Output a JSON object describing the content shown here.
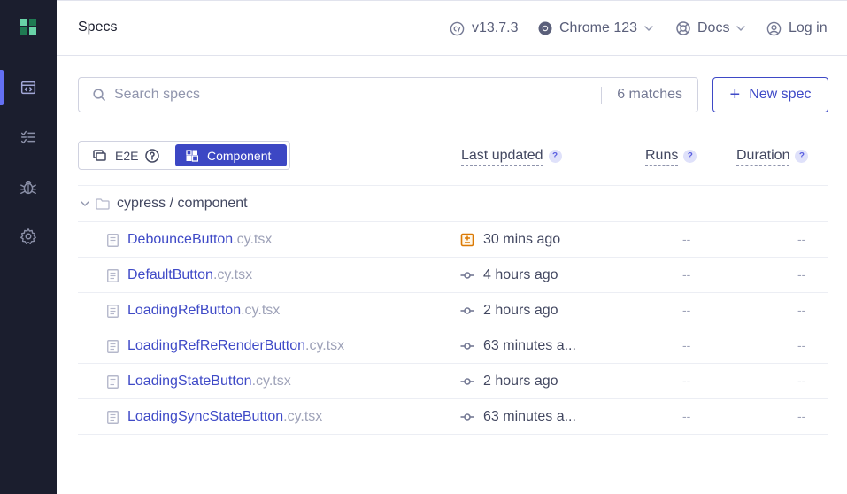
{
  "header": {
    "title": "Specs",
    "version": "v13.7.3",
    "browser": "Chrome 123",
    "docs": "Docs",
    "login": "Log in"
  },
  "sidebar": {
    "items": [
      {
        "icon": "specs-icon",
        "active": true
      },
      {
        "icon": "runs-icon",
        "active": false
      },
      {
        "icon": "debug-icon",
        "active": false
      },
      {
        "icon": "settings-icon",
        "active": false
      }
    ]
  },
  "search": {
    "placeholder": "Search specs",
    "matches": "6 matches",
    "value": ""
  },
  "new_spec_label": "New spec",
  "testing_type": {
    "e2e_label": "E2E",
    "component_label": "Component",
    "selected": "Component"
  },
  "columns": {
    "last_updated": "Last updated",
    "runs": "Runs",
    "duration": "Duration",
    "help": "?"
  },
  "folder": {
    "path": "cypress / component"
  },
  "specs": [
    {
      "name": "DebounceButton",
      "ext": ".cy.tsx",
      "updated": "30 mins ago",
      "updated_icon": "modified-file-icon",
      "runs": "--",
      "duration": "--"
    },
    {
      "name": "DefaultButton",
      "ext": ".cy.tsx",
      "updated": "4 hours ago",
      "updated_icon": "commit-icon",
      "runs": "--",
      "duration": "--"
    },
    {
      "name": "LoadingRefButton",
      "ext": ".cy.tsx",
      "updated": "2 hours ago",
      "updated_icon": "commit-icon",
      "runs": "--",
      "duration": "--"
    },
    {
      "name": "LoadingRefReRenderButton",
      "ext": ".cy.tsx",
      "updated": "63 minutes a...",
      "updated_icon": "commit-icon",
      "runs": "--",
      "duration": "--"
    },
    {
      "name": "LoadingStateButton",
      "ext": ".cy.tsx",
      "updated": "2 hours ago",
      "updated_icon": "commit-icon",
      "runs": "--",
      "duration": "--"
    },
    {
      "name": "LoadingSyncStateButton",
      "ext": ".cy.tsx",
      "updated": "63 minutes a...",
      "updated_icon": "commit-icon",
      "runs": "--",
      "duration": "--"
    }
  ],
  "colors": {
    "sidebar_bg": "#1b1e2e",
    "accent": "#3c47c4",
    "link": "#3f4ac7",
    "modified": "#db7903"
  }
}
